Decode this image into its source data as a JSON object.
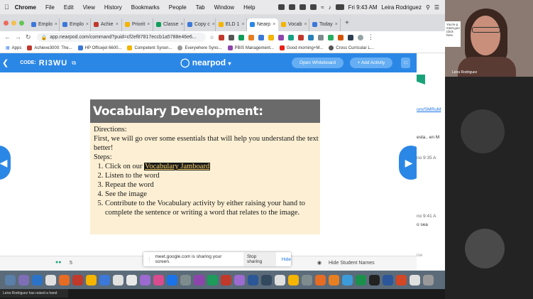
{
  "menubar": {
    "app": "Chrome",
    "items": [
      "File",
      "Edit",
      "View",
      "History",
      "Bookmarks",
      "People",
      "Tab",
      "Window",
      "Help"
    ],
    "clock": "Fri 9:43 AM",
    "user": "Leira Rodriguez"
  },
  "tabs": [
    {
      "label": "Emplo",
      "color": "#3c78d8"
    },
    {
      "label": "Emplo",
      "color": "#3c78d8"
    },
    {
      "label": "Achie",
      "color": "#c0392b"
    },
    {
      "label": "Priorit",
      "color": "#f4b400"
    },
    {
      "label": "Classe",
      "color": "#0f9d58"
    },
    {
      "label": "Copy c",
      "color": "#3c78d8"
    },
    {
      "label": "ELD 1",
      "color": "#f4b400"
    },
    {
      "label": "Nearp",
      "color": "#2b87e6",
      "active": true
    },
    {
      "label": "Vocab",
      "color": "#f4b400"
    },
    {
      "label": "Today",
      "color": "#3c78d8"
    }
  ],
  "address": {
    "url": "app.nearpod.com/command?puid=cf2ef87817eccb1a5788e46e6..."
  },
  "bookmarks": [
    "Apps",
    "Achieve3000: The...",
    "HP Officejet 6600...",
    "Competent Synon...",
    "Everywhere Syno...",
    "PBIS Management...",
    "Good morning+M...",
    "Cross Curricular L..."
  ],
  "nearpod": {
    "code_label": "CODE:",
    "code": "RI3WU",
    "logo": "nearpod",
    "open_whiteboard": "Open Whiteboard",
    "add_activity": "+ Add Activity"
  },
  "slide": {
    "title": "Vocabulary Development:",
    "directions_label": "Directions:",
    "directions_text": "First, we will go over some essentials that will help you understand the text better!",
    "steps_label": "Steps:",
    "step1_prefix": "Click on our ",
    "step1_link": "Vocabulary Jamboard",
    "step2": "Listen to the word",
    "step3": "Repeat the word",
    "step4": "See the image",
    "step5": "Contribute to the Vocabulary activity by either raising your hand to complete the sentence or writing a word that relates to the image."
  },
  "footer": {
    "students_count": "5",
    "hide_names": "Hide Student Names"
  },
  "share_bar": {
    "message": "meet.google.com is sharing your screen.",
    "stop": "Stop sharing",
    "hide": "Hide"
  },
  "raised_hand": "Leira Rodriguez has raised a hand",
  "right_chat": {
    "link": "om/SMRuM",
    "snippet1": "esta.. en M",
    "time1": "no 9:35 A",
    "time2": "no 9:41 A",
    "snippet2": "o sea",
    "snippet3": "ise"
  },
  "video": {
    "name": "Leira Rodriguez",
    "popup": "You're p meet.goo Click here"
  }
}
